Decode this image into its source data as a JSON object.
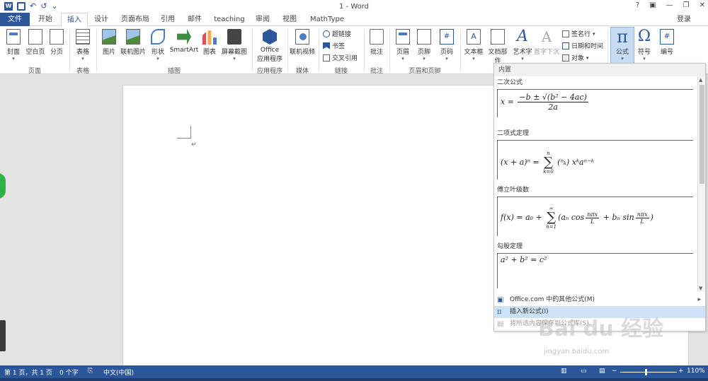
{
  "window": {
    "title": "1 - Word",
    "controls": [
      "?",
      "▣",
      "—",
      "❐",
      "✕"
    ]
  },
  "quick_access": {
    "undo_glyph": "↶",
    "redo_glyph": "↺",
    "more_glyph": "⌄"
  },
  "tabs": [
    "文件",
    "开始",
    "插入",
    "设计",
    "页面布局",
    "引用",
    "邮件",
    "teaching",
    "审阅",
    "视图",
    "MathType"
  ],
  "active_tab": "插入",
  "login": "登录",
  "ribbon": {
    "pages": {
      "cover": "封面",
      "blank": "空白页",
      "break": "分页",
      "group": "页面"
    },
    "tables": {
      "table": "表格",
      "group": "表格"
    },
    "illustrations": {
      "picture": "图片",
      "online_picture": "联机图片",
      "shapes": "形状",
      "smartart": "SmartArt",
      "chart": "图表",
      "screenshot": "屏幕截图",
      "group": "插图"
    },
    "apps": {
      "office_line1": "Office",
      "office_line2": "应用程序",
      "group": "应用程序"
    },
    "media": {
      "online_video": "联机视频",
      "group": "媒体"
    },
    "links": {
      "hyperlink": "超链接",
      "bookmark": "书签",
      "crossref": "交叉引用",
      "group": "链接"
    },
    "comments": {
      "comment": "批注",
      "group": "批注"
    },
    "header_footer": {
      "header": "页眉",
      "footer": "页脚",
      "page_number": "页码",
      "group": "页眉和页脚"
    },
    "text": {
      "textbox": "文本框",
      "quickparts": "文档部件",
      "wordart": "艺术字",
      "dropcap": "首字下沉",
      "signature": "签名行",
      "datetime": "日期和时间",
      "object": "对象"
    },
    "symbols": {
      "equation": "公式",
      "symbol": "符号",
      "number": "编号"
    }
  },
  "equation_panel": {
    "header": "内置",
    "items": [
      {
        "title": "二次公式"
      },
      {
        "title": "二项式定理"
      },
      {
        "title": "傅立叶级数"
      },
      {
        "title": "勾股定理"
      }
    ],
    "menu": {
      "more": "Office.com 中的其他公式(M)",
      "insert_new": "插入新公式(I)",
      "save": "将所选内容保存到公式库(S)..."
    }
  },
  "statusbar": {
    "page": "第 1 页，共 1 页",
    "words": "0 个字",
    "language": "中文(中国)",
    "zoom": "110%"
  },
  "watermark": {
    "text": "Bai du 经验",
    "sub": "jingyan.baidu.com"
  },
  "colors": {
    "accent": "#2b579a",
    "highlight": "#cde2f7"
  }
}
